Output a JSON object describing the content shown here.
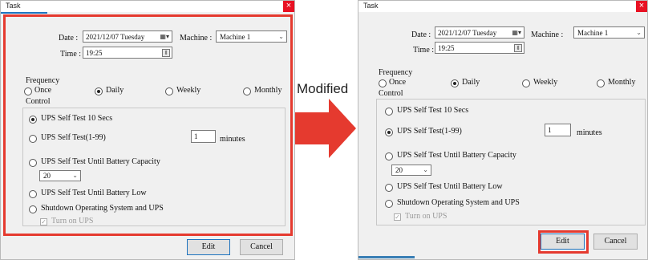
{
  "arrow_label": "Modified",
  "colors": {
    "highlight": "#e53a2f",
    "accent": "#1e73be",
    "close": "#e81123"
  },
  "dialogs": [
    {
      "title": "Task",
      "close_glyph": "×",
      "date_label": "Date :",
      "date_value": "2021/12/07   Tuesday",
      "calendar_glyph": "▦▾",
      "machine_label": "Machine :",
      "machine_value": "Machine 1",
      "dropdown_glyph": "⌄",
      "time_label": "Time :",
      "time_value": "19:25",
      "spin_glyph": "⇕",
      "frequency_label": "Frequency",
      "frequency_options": [
        "Once",
        "Daily",
        "Weekly",
        "Monthly"
      ],
      "frequency_selected": "Daily",
      "control_label": "Control",
      "control_options": [
        "UPS Self Test 10 Secs",
        "UPS Self Test(1-99)",
        "UPS Self Test Until Battery Capacity",
        "UPS Self Test Until Battery Low",
        "Shutdown Operating System and UPS"
      ],
      "control_selected": "UPS Self Test 10 Secs",
      "minutes_value": "1",
      "minutes_label": "minutes",
      "capacity_value": "20",
      "turn_on_ups_label": "Turn on UPS",
      "turn_on_ups_checked": true,
      "check_glyph": "✓",
      "edit_label": "Edit",
      "cancel_label": "Cancel"
    },
    {
      "title": "Task",
      "close_glyph": "×",
      "date_label": "Date :",
      "date_value": "2021/12/07   Tuesday",
      "calendar_glyph": "▦▾",
      "machine_label": "Machine :",
      "machine_value": "Machine 1",
      "dropdown_glyph": "⌄",
      "time_label": "Time :",
      "time_value": "19:25",
      "spin_glyph": "⇕",
      "frequency_label": "Frequency",
      "frequency_options": [
        "Once",
        "Daily",
        "Weekly",
        "Monthly"
      ],
      "frequency_selected": "Daily",
      "control_label": "Control",
      "control_options": [
        "UPS Self Test 10 Secs",
        "UPS Self Test(1-99)",
        "UPS Self Test Until Battery Capacity",
        "UPS Self Test Until Battery Low",
        "Shutdown Operating System and UPS"
      ],
      "control_selected": "UPS Self Test(1-99)",
      "minutes_value": "1",
      "minutes_label": "minutes",
      "capacity_value": "20",
      "turn_on_ups_label": "Turn on UPS",
      "turn_on_ups_checked": true,
      "check_glyph": "✓",
      "edit_label": "Edit",
      "cancel_label": "Cancel"
    }
  ]
}
